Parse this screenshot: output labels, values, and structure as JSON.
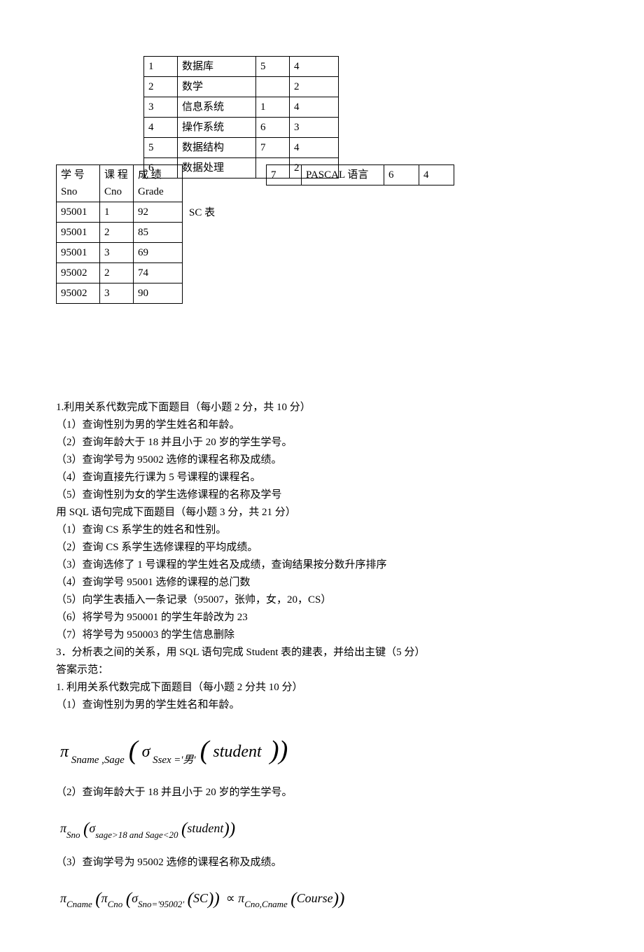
{
  "course_table": {
    "rows": [
      {
        "c1": "1",
        "c2": "数据库",
        "c3": "5",
        "c4": "4"
      },
      {
        "c1": "2",
        "c2": "数学",
        "c3": "",
        "c4": "2"
      },
      {
        "c1": "3",
        "c2": "信息系统",
        "c3": "1",
        "c4": "4"
      },
      {
        "c1": "4",
        "c2": "操作系统",
        "c3": "6",
        "c4": "3"
      },
      {
        "c1": "5",
        "c2": "数据结构",
        "c3": "7",
        "c4": "4"
      },
      {
        "c1": "6",
        "c2": "数据处理",
        "c3": "",
        "c4": "2"
      }
    ]
  },
  "overflow_row": {
    "c1": "7",
    "c2": "PASCAL 语言",
    "c3": "6",
    "c4": "4"
  },
  "sc_table": {
    "label": "SC 表",
    "header": {
      "h1a": "学 号",
      "h1b": "Sno",
      "h2a": "课 程",
      "h2b": "Cno",
      "h3a": "成 绩",
      "h3b": "Grade"
    },
    "rows": [
      {
        "c1": "95001",
        "c2": "1",
        "c3": "92"
      },
      {
        "c1": "95001",
        "c2": "2",
        "c3": "85"
      },
      {
        "c1": "95001",
        "c2": "3",
        "c3": "69"
      },
      {
        "c1": "95002",
        "c2": "2",
        "c3": "74"
      },
      {
        "c1": "95002",
        "c2": "3",
        "c3": "90"
      }
    ]
  },
  "q1": {
    "title": "1.利用关系代数完成下面题目（每小题 2 分，共 10 分）",
    "i1": "（1）查询性别为男的学生姓名和年龄。",
    "i2": "（2）查询年龄大于 18 并且小于 20 岁的学生学号。",
    "i3": "（3）查询学号为 95002 选修的课程名称及成绩。",
    "i4": "（4）查询直接先行课为 5 号课程的课程名。",
    "i5": "（5）查询性别为女的学生选修课程的名称及学号"
  },
  "q2": {
    "title": "用 SQL 语句完成下面题目（每小题 3 分，共 21 分）",
    "i1": "（1）查询 CS 系学生的姓名和性别。",
    "i2": "（2）查询 CS 系学生选修课程的平均成绩。",
    "i3": "（3）查询选修了 1 号课程的学生姓名及成绩，查询结果按分数升序排序",
    "i4": "（4）查询学号 95001 选修的课程的总门数",
    "i5": "（5）向学生表插入一条记录（95007，张帅，女，20，CS）",
    "i6": "（6）将学号为 950001 的学生年龄改为 23",
    "i7": "（7）将学号为 950003 的学生信息删除"
  },
  "q3": "3．分析表之间的关系，用 SQL 语句完成 Student 表的建表，并给出主键（5 分）",
  "ans_header": "答案示范：",
  "a1": {
    "title": "1. 利用关系代数完成下面题目（每小题 2 分共 10 分）",
    "i1": "（1）查询性别为男的学生姓名和年龄。",
    "i2": "（2）查询年龄大于 18 并且小于 20 岁的学生学号。",
    "i3": "（3）查询学号为 95002 选修的课程名称及成绩。"
  },
  "formulas": {
    "f1": {
      "pi_sub": "Sname ,Sage",
      "sigma_sub": "Ssex ='男'",
      "rel": "student"
    },
    "f2": {
      "pi_sub": "Sno",
      "sigma_sub": "sage>18 and Sage<20",
      "rel": "student"
    },
    "f3": {
      "pi1_sub": "Cname",
      "pi2_sub": "Cno",
      "sigma_sub": "Sno='95002'",
      "rel1": "SC",
      "pi3_sub": "Cno,Cname",
      "rel2": "Course"
    }
  }
}
